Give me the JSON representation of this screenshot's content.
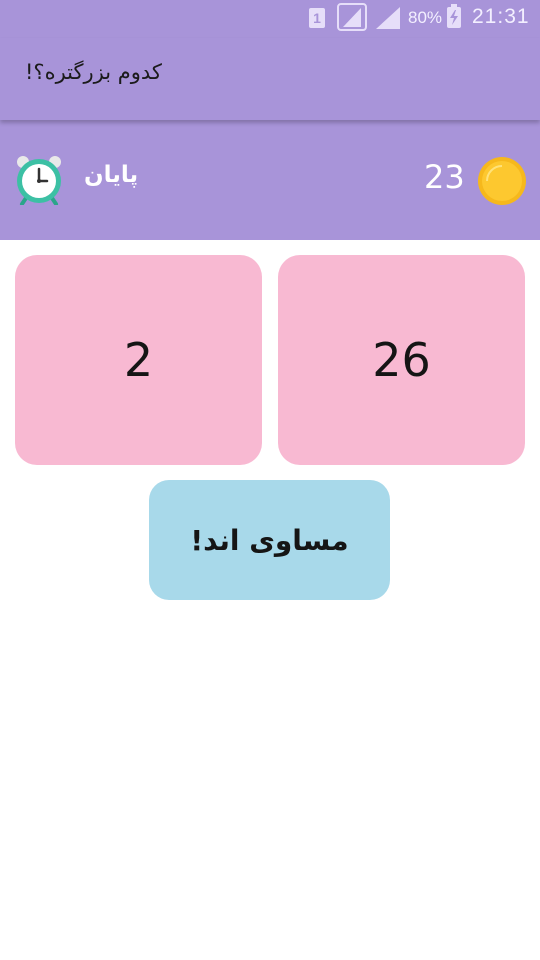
{
  "status_bar": {
    "sim_label": "1",
    "battery_percent": "80%",
    "time": "21:31",
    "icons": [
      "sim-icon",
      "signal-icon",
      "signal-icon",
      "battery-charging-icon"
    ]
  },
  "app_bar": {
    "title": "کدوم بزرگتره؟!"
  },
  "info_bar": {
    "end_label": "پایان",
    "score": "23",
    "icons": [
      "alarm-clock-icon",
      "coin-icon"
    ]
  },
  "cards": {
    "left_value": "2",
    "right_value": "26"
  },
  "equal_button": {
    "label": "مساوی اند!"
  },
  "colors": {
    "primary": "#a894d9",
    "card_pink": "#f8b9d2",
    "button_blue": "#a8d9ea",
    "coin_gold": "#fdc82f",
    "clock_teal": "#3cc0a4"
  }
}
